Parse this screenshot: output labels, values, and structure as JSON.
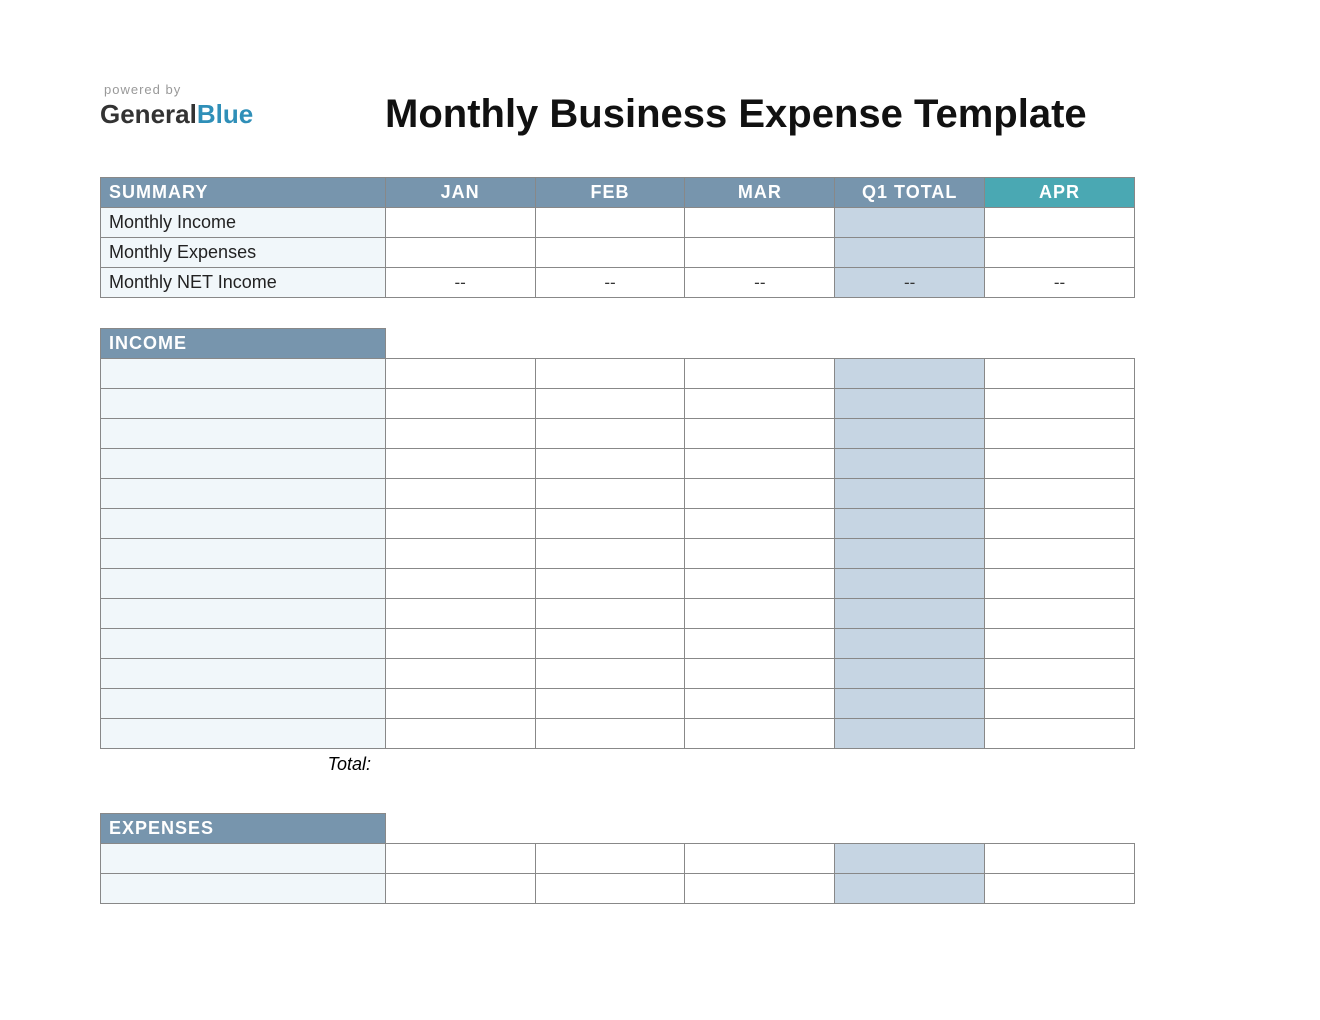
{
  "logo": {
    "powered_by": "powered by",
    "general": "General",
    "blue": "Blue"
  },
  "title": "Monthly Business Expense Template",
  "columns": {
    "jan": "JAN",
    "feb": "FEB",
    "mar": "MAR",
    "q1": "Q1 TOTAL",
    "apr": "APR"
  },
  "summary": {
    "header": "SUMMARY",
    "rows": {
      "income": "Monthly Income",
      "expenses": "Monthly Expenses",
      "net": "Monthly NET Income"
    },
    "net_values": {
      "jan": "--",
      "feb": "--",
      "mar": "--",
      "q1": "--",
      "apr": "--"
    }
  },
  "income": {
    "header": "INCOME",
    "total_label": "Total:",
    "row_count": 13
  },
  "expenses": {
    "header": "EXPENSES",
    "row_count": 2
  }
}
